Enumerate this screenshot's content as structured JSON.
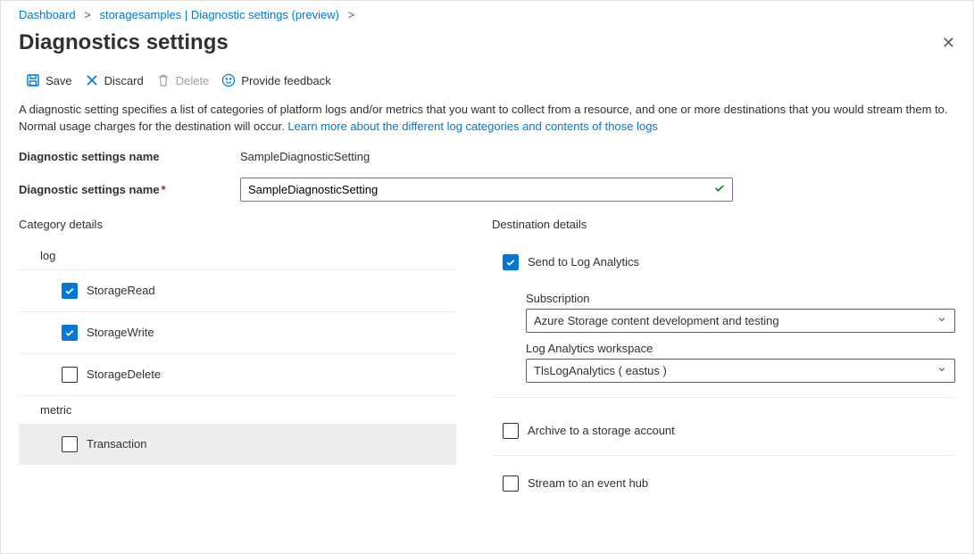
{
  "breadcrumb": {
    "items": [
      {
        "label": "Dashboard"
      },
      {
        "label": "storagesamples | Diagnostic settings (preview)"
      }
    ],
    "sep": ">"
  },
  "page_title": "Diagnostics settings",
  "toolbar": {
    "save": "Save",
    "discard": "Discard",
    "delete": "Delete",
    "feedback": "Provide feedback"
  },
  "description": {
    "text": "A diagnostic setting specifies a list of categories of platform logs and/or metrics that you want to collect from a resource, and one or more destinations that you would stream them to. Normal usage charges for the destination will occur. ",
    "link": "Learn more about the different log categories and contents of those logs"
  },
  "name_row": {
    "label": "Diagnostic settings name",
    "value": "SampleDiagnosticSetting"
  },
  "name_input": {
    "label": "Diagnostic settings name",
    "value": "SampleDiagnosticSetting"
  },
  "category": {
    "title": "Category details",
    "log_title": "log",
    "metric_title": "metric",
    "logs": [
      {
        "label": "StorageRead",
        "checked": true
      },
      {
        "label": "StorageWrite",
        "checked": true
      },
      {
        "label": "StorageDelete",
        "checked": false
      }
    ],
    "metrics": [
      {
        "label": "Transaction",
        "checked": false
      }
    ]
  },
  "destination": {
    "title": "Destination details",
    "log_analytics": {
      "label": "Send to Log Analytics",
      "checked": true,
      "subscription_label": "Subscription",
      "subscription_value": "Azure Storage content development and testing",
      "workspace_label": "Log Analytics workspace",
      "workspace_value": "TlsLogAnalytics ( eastus )"
    },
    "storage": {
      "label": "Archive to a storage account",
      "checked": false
    },
    "eventhub": {
      "label": "Stream to an event hub",
      "checked": false
    }
  }
}
